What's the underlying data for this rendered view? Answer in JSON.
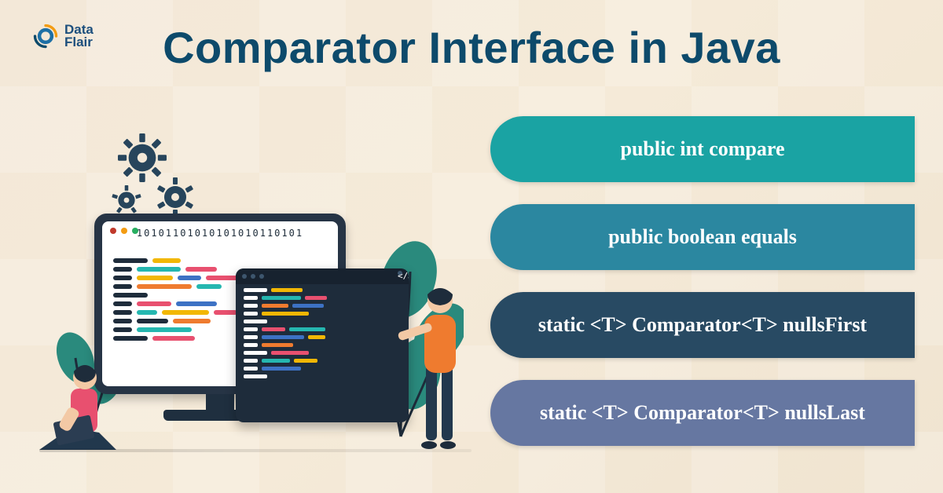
{
  "brand": {
    "name_line1": "Data",
    "name_line2": "Flair"
  },
  "title": "Comparator Interface in Java",
  "pills": [
    {
      "label": "public int compare",
      "color": "#1aa3a3"
    },
    {
      "label": "public boolean equals",
      "color": "#2b87a0"
    },
    {
      "label": "static <T> Comparator<T> nullsFirst",
      "color": "#284a63"
    },
    {
      "label": "static <T> Comparator<T> nullsLast",
      "color": "#6677a1"
    }
  ],
  "illustration": {
    "binary_string": "10101101010101010110101",
    "dot_colors": [
      "#c0392b",
      "#f39c12",
      "#27ae60"
    ],
    "code_icon": "</>",
    "palette": {
      "dark": "#1e2c3b",
      "yellow": "#f2b705",
      "pink": "#e8506f",
      "teal": "#25b7b0",
      "blue": "#3d72c4",
      "orange": "#ef7b2f",
      "white": "#ffffff"
    }
  }
}
